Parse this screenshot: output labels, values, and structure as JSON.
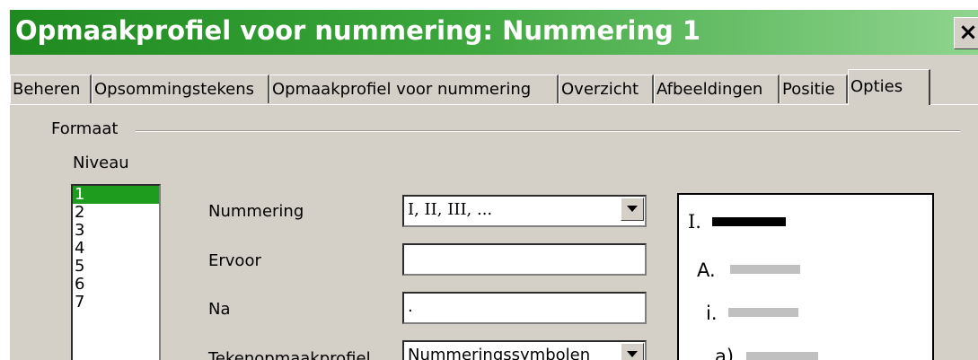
{
  "window": {
    "title": "Opmaakprofiel voor nummering: Nummering 1",
    "close_label": "×"
  },
  "tabs": [
    {
      "label": "Beheren"
    },
    {
      "label": "Opsommingstekens"
    },
    {
      "label": "Opmaakprofiel voor nummering"
    },
    {
      "label": "Overzicht"
    },
    {
      "label": "Afbeeldingen"
    },
    {
      "label": "Positie"
    },
    {
      "label": "Opties"
    }
  ],
  "active_tab": "Opties",
  "format": {
    "group_label": "Formaat",
    "level_label": "Niveau",
    "levels": [
      "1",
      "2",
      "3",
      "4",
      "5",
      "6",
      "7"
    ],
    "selected_level": "1",
    "numbering": {
      "label": "Nummering",
      "value": "I, II, III, ..."
    },
    "before": {
      "label": "Ervoor",
      "value": ""
    },
    "after": {
      "label": "Na",
      "value": "."
    },
    "char_style": {
      "label": "Tekenopmaakprofiel",
      "value": "Nummeringssymbolen"
    }
  },
  "preview": {
    "items": [
      {
        "prefix": "I."
      },
      {
        "prefix": "A."
      },
      {
        "prefix": "i."
      },
      {
        "prefix": "a)"
      }
    ],
    "active_bar_color": "#000000",
    "inactive_bar_color": "#c0c0c0"
  },
  "colors": {
    "title_green": "#1f8a1f",
    "selection_green": "#1e9c1e",
    "dialog_bg": "#d4d0c8"
  }
}
